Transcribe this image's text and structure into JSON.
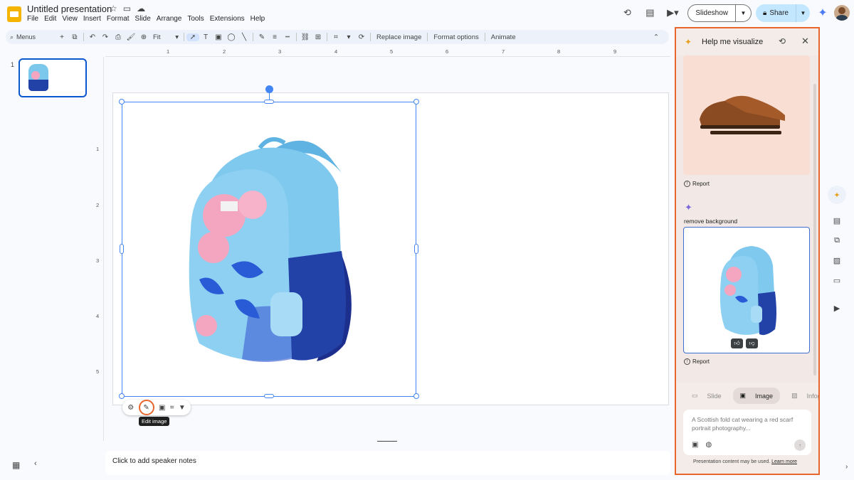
{
  "app": {
    "doc_title": "Untitled presentation",
    "menu": [
      "File",
      "Edit",
      "View",
      "Insert",
      "Format",
      "Slide",
      "Arrange",
      "Tools",
      "Extensions",
      "Help"
    ],
    "slideshow_label": "Slideshow",
    "share_label": "Share"
  },
  "toolbar": {
    "search_label": "Menus",
    "zoom_label": "Fit",
    "replace_image": "Replace image",
    "format_options": "Format options",
    "animate": "Animate"
  },
  "filmstrip": {
    "slide_number": "1"
  },
  "ruler": {
    "top_labels": [
      "1",
      "2",
      "3",
      "4",
      "5",
      "6",
      "7",
      "8",
      "9"
    ],
    "left_labels": [
      "1",
      "2",
      "3",
      "4",
      "5"
    ]
  },
  "canvas": {
    "tooltip": "Edit image",
    "speaker_notes_placeholder": "Click to add speaker notes"
  },
  "panel": {
    "title": "Help me visualize",
    "report_label": "Report",
    "prompt_echo": "remove background",
    "tabs": [
      {
        "label": "Slide",
        "active": false
      },
      {
        "label": "Image",
        "active": true
      },
      {
        "label": "Infographic",
        "active": false
      }
    ],
    "input_placeholder": "A Scottish fold cat wearing a red scarf portrait photography...",
    "disclaimer": "Presentation content may be used.",
    "learn_more": "Learn more"
  },
  "colors": {
    "accent_blue": "#0b57d0",
    "share_bg": "#c2e7ff",
    "panel_border": "#e8662d",
    "panel_bg": "#f2e9e6"
  }
}
